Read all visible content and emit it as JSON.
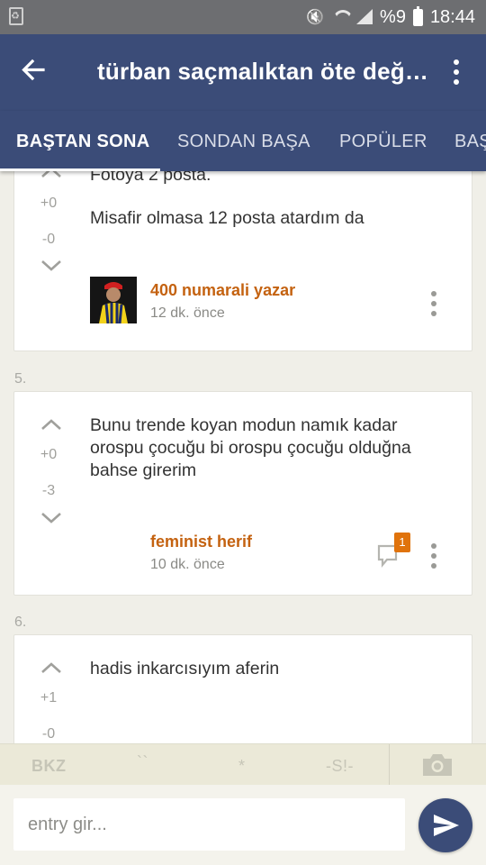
{
  "status_bar": {
    "battery_text": "%9",
    "time": "18:44"
  },
  "app_bar": {
    "title": "türban saçmalıktan öte değil..."
  },
  "tabs": [
    {
      "label": "BAŞTAN SONA",
      "active": true
    },
    {
      "label": "SONDAN BAŞA",
      "active": false
    },
    {
      "label": "POPÜLER",
      "active": false
    },
    {
      "label": "BAŞ",
      "active": false
    }
  ],
  "entries": [
    {
      "number": "",
      "text_lines": [
        "Fotoya 2 posta.",
        "Misafir olmasa 12 posta atardım da"
      ],
      "upvotes": "+0",
      "downvotes": "-0",
      "author": "400 numarali yazar",
      "time": "12 dk. önce",
      "has_avatar": true
    },
    {
      "number": "5.",
      "text": "Bunu trende koyan modun namık kadar orospu çocuğu bi orospu çocuğu olduğna bahse girerim",
      "upvotes": "+0",
      "downvotes": "-3",
      "author": "feminist herif",
      "time": "10 dk. önce",
      "message_count": "1"
    },
    {
      "number": "6.",
      "text": "hadis inkarcısıyım aferin",
      "upvotes": "+1",
      "downvotes": "-0"
    }
  ],
  "toolbar": {
    "bkz": "BKZ",
    "backticks": "``",
    "asterisk": "*",
    "spoiler": "-S!-"
  },
  "composer": {
    "placeholder": "entry gir..."
  },
  "colors": {
    "primary": "#3b4c78",
    "author": "#c46210",
    "badge": "#e0730c"
  }
}
